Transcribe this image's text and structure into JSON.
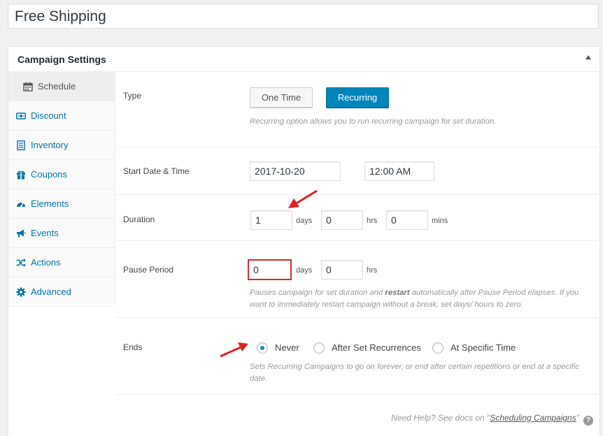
{
  "campaign_title": "Free Shipping",
  "panel": {
    "title": "Campaign Settings"
  },
  "sidebar": {
    "items": [
      {
        "label": "Schedule",
        "icon": "calendar-icon",
        "active": true
      },
      {
        "label": "Discount",
        "icon": "money-icon"
      },
      {
        "label": "Inventory",
        "icon": "list-icon"
      },
      {
        "label": "Coupons",
        "icon": "gift-icon"
      },
      {
        "label": "Elements",
        "icon": "dashboard-icon"
      },
      {
        "label": "Events",
        "icon": "megaphone-icon"
      },
      {
        "label": "Actions",
        "icon": "shuffle-icon"
      },
      {
        "label": "Advanced",
        "icon": "gear-icon"
      }
    ]
  },
  "schedule": {
    "type": {
      "label": "Type",
      "one_time": "One Time",
      "recurring": "Recurring",
      "selected": "Recurring",
      "desc": "Recurring option allows you to run recurring campaign for set duration."
    },
    "start": {
      "label": "Start Date & Time",
      "date": "2017-10-20",
      "time": "12:00 AM"
    },
    "duration": {
      "label": "Duration",
      "days": "1",
      "days_unit": "days",
      "hrs": "0",
      "hrs_unit": "hrs",
      "mins": "0",
      "mins_unit": "mins"
    },
    "pause": {
      "label": "Pause Period",
      "days": "0",
      "days_unit": "days",
      "hrs": "0",
      "hrs_unit": "hrs",
      "desc_1": "Pauses campaign for set duration and ",
      "desc_bold": "restart",
      "desc_2": " automatically after Pause Period elapses. If you want to immediately restart campaign without a break, set days/ hours to zero."
    },
    "ends": {
      "label": "Ends",
      "options": [
        "Never",
        "After Set Recurrences",
        "At Specific Time"
      ],
      "selected": "Never",
      "desc": "Sets Recurring Campaigns to go on forever, or end after certain repetitions or end at a specific date."
    }
  },
  "help": {
    "prefix": "Need Help? See docs on \"",
    "link": "Scheduling Campaigns",
    "suffix": "\""
  },
  "colors": {
    "primary": "#0085ba",
    "link": "#0073aa",
    "annotation": "#e02020"
  }
}
